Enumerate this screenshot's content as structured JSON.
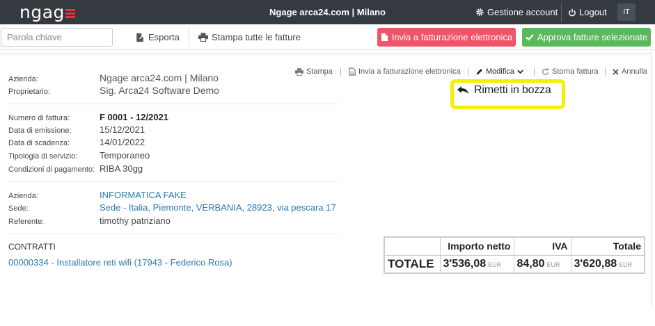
{
  "navbar": {
    "logo": "ngag",
    "title": "Ngage arca24.com | Milano",
    "account_label": "Gestione account",
    "logout_label": "Logout",
    "lang": "IT",
    "icons": [
      "gear-icon",
      "power-icon"
    ]
  },
  "toolbar": {
    "search_placeholder": "Parola chiave",
    "export_label": "Esporta",
    "print_all_label": "Stampa tutte le fatture",
    "send_einvoice_label": "Invia a fatturazione elettronica",
    "approve_label": "Approva fatture selezionate",
    "colors": {
      "red": "#f05468",
      "green": "#5cb85c"
    }
  },
  "company": {
    "azienda_label": "Azienda:",
    "azienda_value": "Ngage arca24.com | Milano",
    "proprietario_label": "Proprietario:",
    "proprietario_value": "Sig. Arca24 Software Demo"
  },
  "invoice": {
    "numero_label": "Numero di fattura:",
    "numero_value": "F 0001 - 12/2021",
    "emissione_label": "Data di emissione:",
    "emissione_value": "15/12/2021",
    "scadenza_label": "Data di scadenza:",
    "scadenza_value": "14/01/2022",
    "tipologia_label": "Tipologia di servizio:",
    "tipologia_value": "Temporaneo",
    "condizioni_label": "Condizioni di pagamento:",
    "condizioni_value": "RIBA 30gg"
  },
  "client": {
    "azienda_label": "Azienda:",
    "azienda_value": "INFORMATICA FAKE",
    "sede_label": "Sede:",
    "sede_value": "Sede - Italia, Piemonte, VERBANIA, 28923, via pescara 17",
    "referente_label": "Referente:",
    "referente_value": "timothy patriziano"
  },
  "contratti": {
    "title": "CONTRATTI",
    "items": [
      "00000334 - Installatore reti wifi (17943 - Federico Rosa)"
    ]
  },
  "actions": {
    "stampa": "Stampa",
    "invia": "Invia a fatturazione elettronica",
    "modifica": "Modifica",
    "storna": "Storna fattura",
    "annulla": "Annulla",
    "separator": "|"
  },
  "dropdown": {
    "rimetti": "Rimetti in bozza",
    "highlight_color": "#f5ef00"
  },
  "totals": {
    "headers": [
      "Importo netto",
      "IVA",
      "Totale"
    ],
    "row_label": "TOTALE",
    "importo_netto": "3'536,08",
    "iva": "84,80",
    "totale": "3'620,88",
    "currency": "EUR"
  }
}
